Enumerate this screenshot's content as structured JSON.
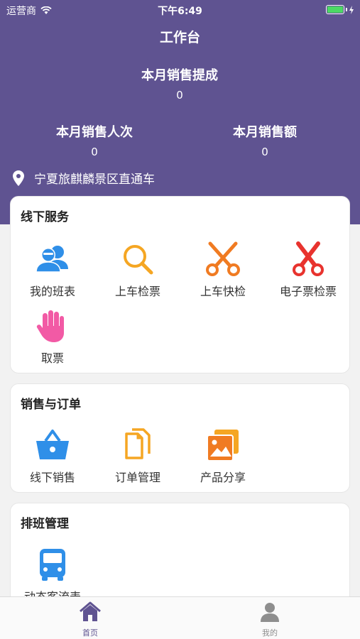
{
  "status_bar": {
    "carrier": "运营商",
    "time": "下午6:49"
  },
  "header": {
    "title": "工作台",
    "commission_label": "本月销售提成",
    "commission_value": "0",
    "count_label": "本月销售人次",
    "count_value": "0",
    "amount_label": "本月销售额",
    "amount_value": "0",
    "location": "宁夏旅麒麟景区直通车"
  },
  "offline_service": {
    "title": "线下服务",
    "items": [
      {
        "label": "我的班表",
        "icon": "users-icon"
      },
      {
        "label": "上车检票",
        "icon": "search-icon"
      },
      {
        "label": "上车快检",
        "icon": "scissors-icon"
      },
      {
        "label": "电子票检票",
        "icon": "scissors-icon"
      },
      {
        "label": "取票",
        "icon": "hand-icon"
      }
    ]
  },
  "sales_orders": {
    "title": "销售与订单",
    "items": [
      {
        "label": "线下销售",
        "icon": "basket-icon"
      },
      {
        "label": "订单管理",
        "icon": "documents-icon"
      },
      {
        "label": "产品分享",
        "icon": "image-icon"
      }
    ]
  },
  "scheduling": {
    "title": "排班管理",
    "items": [
      {
        "label": "动态客流表",
        "icon": "bus-icon"
      }
    ]
  },
  "tabbar": {
    "home_label": "首页",
    "mine_label": "我的"
  },
  "colors": {
    "header": "#5f5391",
    "blue": "#2f8fe8",
    "orange": "#f5a623",
    "red": "#e8332e",
    "pink": "#f25aa5",
    "tab_active": "#5f5391",
    "tab_inactive": "#8e8e8e"
  }
}
